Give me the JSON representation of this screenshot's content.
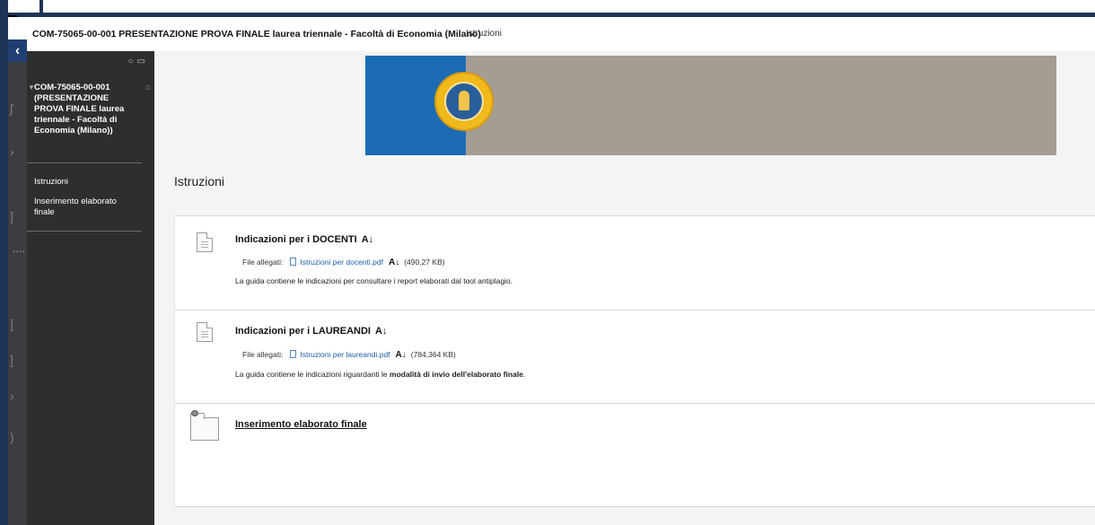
{
  "header": {
    "course_title": "COM-75065-00-001 PRESENTAZIONE PROVA FINALE laurea triennale - Facoltà di Economia (Milano)",
    "breadcrumb": "Istruzioni"
  },
  "sidebar": {
    "course_name": "COM-75065-00-001 (PRESENTAZIONE PROVA FINALE laurea triennale - Facoltà di Economia (Milano))",
    "links": [
      {
        "label": "Istruzioni"
      },
      {
        "label": "Inserimento elaborato finale"
      }
    ]
  },
  "page": {
    "heading": "Istruzioni"
  },
  "items": [
    {
      "title": "Indicazioni per i DOCENTI",
      "attach_label": "File allegati:",
      "file_name": "Istruzioni per docenti.pdf",
      "file_size": "(490,27 KB)",
      "desc": "La guida contiene le indicazioni per consultare i report elaborati dal tool antiplagio."
    },
    {
      "title": "Indicazioni per i LAUREANDI",
      "attach_label": "File allegati:",
      "file_name": "Istruzioni per laureandi.pdf",
      "file_size": "(784,364 KB)",
      "desc_pre": "La guida contiene le indicazioni riguardanti le ",
      "desc_bold": "modalità di invio dell'elaborato finale",
      "desc_post": "."
    },
    {
      "title": "Inserimento elaborato finale"
    }
  ],
  "icons": {
    "alt_format": "A↓"
  },
  "colors": {
    "banner_blue": "#1b6cb4",
    "banner_taupe": "#a59c92",
    "sidebar_bg": "#2d2e30",
    "link": "#1a5fa8"
  }
}
